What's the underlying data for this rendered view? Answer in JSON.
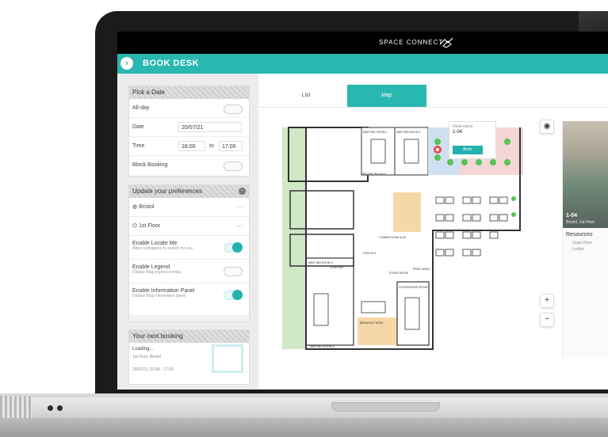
{
  "app": {
    "brand": "SPACE CONNECT",
    "header_title": "BOOK DESK"
  },
  "colors": {
    "accent": "#2ab7b2",
    "topbar": "#000000"
  },
  "sidebar": {
    "pick_date": {
      "title": "Pick a Date",
      "all_day_label": "All-day",
      "date_label": "Date",
      "date_value": "20/07/21",
      "time_label": "Time",
      "time_from": "16:00",
      "time_to_label": "to",
      "time_to": "17:00",
      "block_booking_label": "Block Booking"
    },
    "preferences": {
      "title": "Update your preferences",
      "location": "Bristol",
      "floor": "1st Floor",
      "locate_me_label": "Enable Locate Me",
      "locate_me_desc": "Allow colleagues to search for you",
      "legend_label": "Enable Legend",
      "legend_desc": "Display Map legend overlay",
      "info_panel_label": "Enable Information Panel",
      "info_panel_desc": "Display Map information panel",
      "more_icon": "⋯"
    },
    "next_booking": {
      "title": "Your next booking",
      "status": "Loading...",
      "location": "1st Floor, Bristol",
      "datetime": "20/07/21, 01:00 - 17:00"
    }
  },
  "main": {
    "tabs": [
      {
        "label": "List"
      },
      {
        "label": "Map"
      }
    ],
    "tooltip": {
      "desk_name_label": "Desk name:",
      "desk_name": "1-04",
      "book_label": "Book"
    },
    "zoom_in": "+",
    "zoom_out": "−",
    "rooms": {
      "meeting_room_1": "MEETING ROOM 1",
      "meeting_room_2": "MEETING ROOM 2",
      "teapoint": "TEAPOINT",
      "comms_room": "COMMS ROOM & AC",
      "store_room": "STORE ROOM",
      "print_area": "PRINT AREA",
      "conference_room": "CONFERENCE ROOM",
      "breakout": "BREAKOUT AREA",
      "fire_exit": "FIRE EXIT",
      "meeting_room_3": "MEETING ROOM 3",
      "meeting_room_4": "MEETING ROOM 4",
      "meeting_room_5": "MEETING ROOM 5"
    }
  },
  "info_panel": {
    "desk_id": "1-04",
    "desk_location": "Bristol, 1st Floor",
    "resources_title": "Resources",
    "resources": [
      "Quiet Zone",
      "Locker"
    ]
  }
}
